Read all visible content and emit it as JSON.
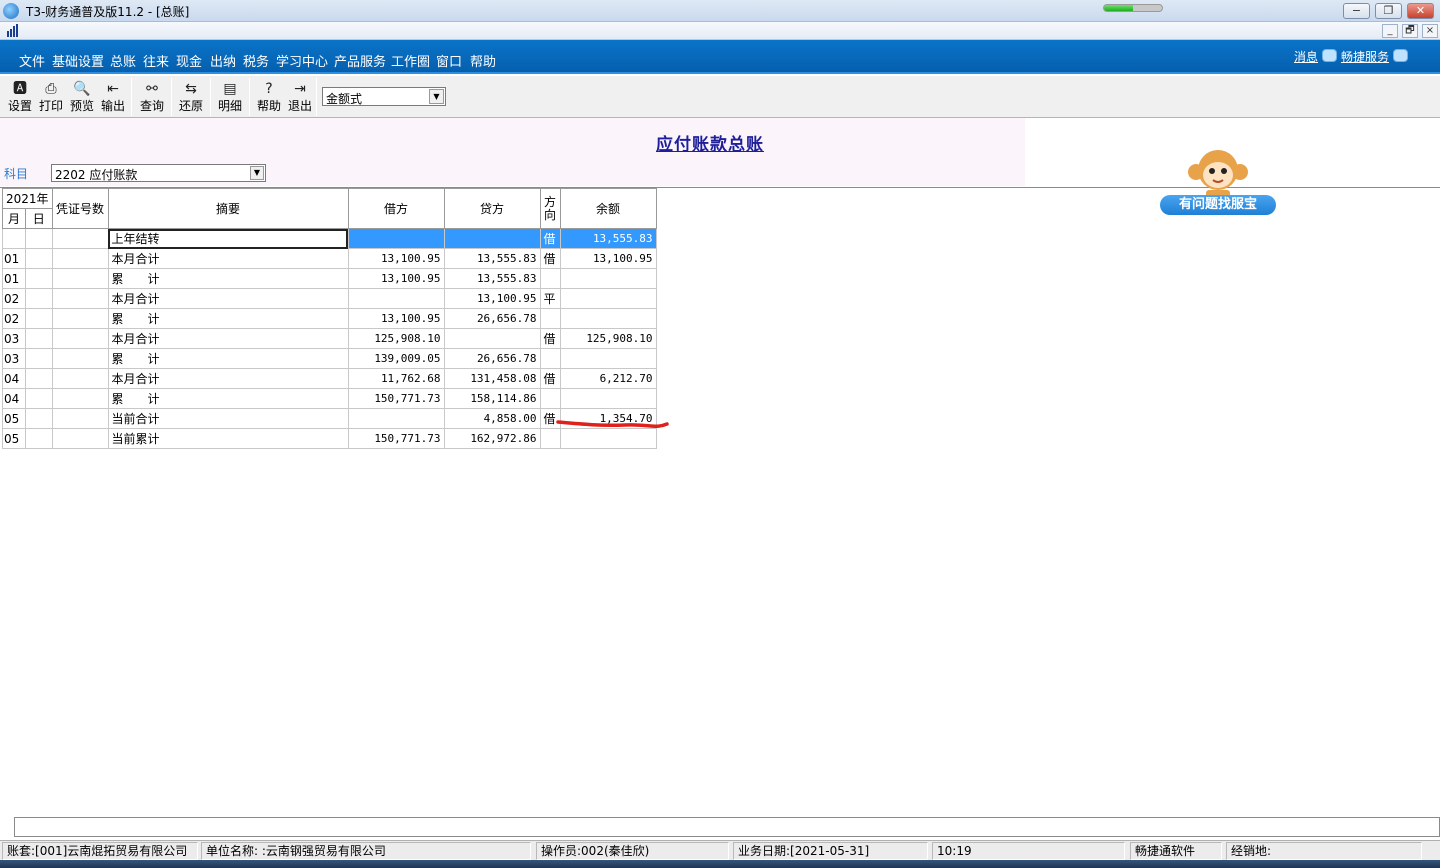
{
  "window": {
    "title": "T3-财务通普及版11.2 - [总账]",
    "progress_fraction": 0.5
  },
  "mdi": {
    "min_label": "_",
    "restore_label": "🗗",
    "close_label": "×"
  },
  "menu": {
    "items": [
      "文件",
      "基础设置",
      "总账",
      "往来",
      "现金",
      "出纳",
      "税务",
      "学习中心",
      "产品服务",
      "工作圈",
      "窗口",
      "帮助"
    ],
    "message_label": "消息",
    "service_label": "畅捷服务"
  },
  "toolbar": {
    "buttons": [
      {
        "label": "设置",
        "icon": "settings-icon"
      },
      {
        "label": "打印",
        "icon": "print-icon"
      },
      {
        "label": "预览",
        "icon": "preview-icon"
      },
      {
        "label": "输出",
        "icon": "export-icon"
      },
      {
        "label": "查询",
        "icon": "binoculars-icon"
      },
      {
        "label": "还原",
        "icon": "restore-icon"
      },
      {
        "label": "明细",
        "icon": "detail-icon"
      },
      {
        "label": "帮助",
        "icon": "help-icon"
      },
      {
        "label": "退出",
        "icon": "exit-icon"
      }
    ],
    "format_value": "金额式"
  },
  "report": {
    "title": "应付账款总账",
    "subject_label": "科目",
    "subject_value": "2202 应付账款"
  },
  "mascot": {
    "label": "有问题找服宝"
  },
  "table": {
    "year_header": "2021年",
    "month_header": "月",
    "day_header": "日",
    "voucher_header": "凭证号数",
    "summary_header": "摘要",
    "debit_header": "借方",
    "credit_header": "贷方",
    "direction_header": "方向",
    "balance_header": "余额",
    "rows": [
      {
        "month": "",
        "day": "",
        "voucher": "",
        "summary": "上年结转",
        "debit": "",
        "credit": "",
        "dir": "借",
        "balance": "13,555.83"
      },
      {
        "month": "01",
        "day": "",
        "voucher": "",
        "summary": "本月合计",
        "debit": "13,100.95",
        "credit": "13,555.83",
        "dir": "借",
        "balance": "13,100.95"
      },
      {
        "month": "01",
        "day": "",
        "voucher": "",
        "summary": "累　　计",
        "debit": "13,100.95",
        "credit": "13,555.83",
        "dir": "",
        "balance": ""
      },
      {
        "month": "02",
        "day": "",
        "voucher": "",
        "summary": "本月合计",
        "debit": "",
        "credit": "13,100.95",
        "dir": "平",
        "balance": ""
      },
      {
        "month": "02",
        "day": "",
        "voucher": "",
        "summary": "累　　计",
        "debit": "13,100.95",
        "credit": "26,656.78",
        "dir": "",
        "balance": ""
      },
      {
        "month": "03",
        "day": "",
        "voucher": "",
        "summary": "本月合计",
        "debit": "125,908.10",
        "credit": "",
        "dir": "借",
        "balance": "125,908.10"
      },
      {
        "month": "03",
        "day": "",
        "voucher": "",
        "summary": "累　　计",
        "debit": "139,009.05",
        "credit": "26,656.78",
        "dir": "",
        "balance": ""
      },
      {
        "month": "04",
        "day": "",
        "voucher": "",
        "summary": "本月合计",
        "debit": "11,762.68",
        "credit": "131,458.08",
        "dir": "借",
        "balance": "6,212.70"
      },
      {
        "month": "04",
        "day": "",
        "voucher": "",
        "summary": "累　　计",
        "debit": "150,771.73",
        "credit": "158,114.86",
        "dir": "",
        "balance": ""
      },
      {
        "month": "05",
        "day": "",
        "voucher": "",
        "summary": "当前合计",
        "debit": "",
        "credit": "4,858.00",
        "dir": "借",
        "balance": "1,354.70"
      },
      {
        "month": "05",
        "day": "",
        "voucher": "",
        "summary": "当前累计",
        "debit": "150,771.73",
        "credit": "162,972.86",
        "dir": "",
        "balance": ""
      }
    ]
  },
  "status": {
    "account": "账套:[001]云南焜拓贸易有限公司",
    "company": "单位名称: :云南钢强贸易有限公司",
    "operator": "操作员:002(秦佳欣)",
    "business_date": "业务日期:[2021-05-31]",
    "time": "10:19",
    "vendor": "畅捷通软件",
    "dealer": "经销地:"
  },
  "colors": {
    "menubar": "#0a74c8",
    "selection": "#3399ff",
    "title_text": "#1f1f9a",
    "annotation": "#e0201a"
  }
}
